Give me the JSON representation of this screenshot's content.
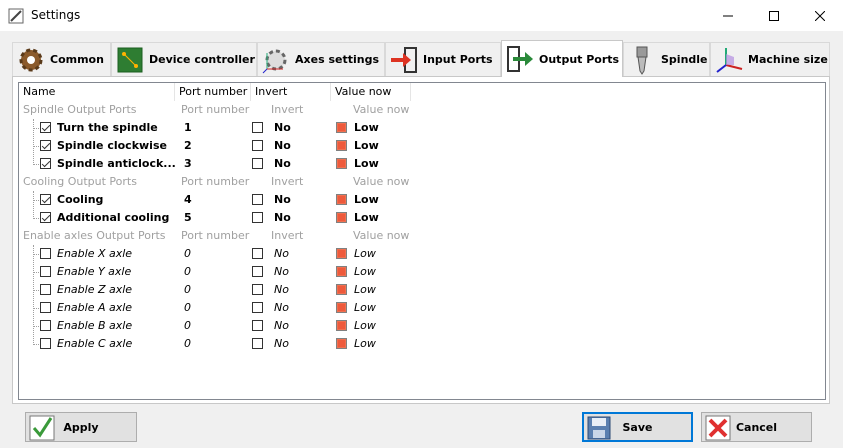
{
  "window": {
    "title": "Settings"
  },
  "tabs": [
    {
      "label": "Common",
      "icon": "gear-icon"
    },
    {
      "label": "Device controller",
      "icon": "circuit-board-icon"
    },
    {
      "label": "Axes settings",
      "icon": "axes-gear-icon"
    },
    {
      "label": "Input Ports",
      "icon": "input-arrow-icon"
    },
    {
      "label": "Output Ports",
      "icon": "output-arrow-icon",
      "active": true
    },
    {
      "label": "Spindle",
      "icon": "spindle-icon"
    },
    {
      "label": "Machine size",
      "icon": "machine-size-icon"
    }
  ],
  "table": {
    "headers": {
      "name": "Name",
      "port": "Port number",
      "invert": "Invert",
      "value": "Value now"
    },
    "groups": [
      {
        "name": "Spindle Output Ports",
        "port": "Port number",
        "invert": "Invert",
        "value": "Value now",
        "items": [
          {
            "name": "Turn the spindle",
            "checked": true,
            "port": "1",
            "invert": "No",
            "value": "Low"
          },
          {
            "name": "Spindle clockwise",
            "checked": true,
            "port": "2",
            "invert": "No",
            "value": "Low"
          },
          {
            "name": "Spindle anticlock...",
            "checked": true,
            "port": "3",
            "invert": "No",
            "value": "Low"
          }
        ]
      },
      {
        "name": "Cooling Output Ports",
        "port": "Port number",
        "invert": "Invert",
        "value": "Value now",
        "items": [
          {
            "name": "Cooling",
            "checked": true,
            "port": "4",
            "invert": "No",
            "value": "Low"
          },
          {
            "name": "Additional cooling",
            "checked": true,
            "port": "5",
            "invert": "No",
            "value": "Low"
          }
        ]
      },
      {
        "name": "Enable axles Output Ports",
        "port": "Port number",
        "invert": "Invert",
        "value": "Value now",
        "items": [
          {
            "name": "Enable X axle",
            "checked": false,
            "port": "0",
            "invert": "No",
            "value": "Low"
          },
          {
            "name": "Enable Y axle",
            "checked": false,
            "port": "0",
            "invert": "No",
            "value": "Low"
          },
          {
            "name": "Enable Z axle",
            "checked": false,
            "port": "0",
            "invert": "No",
            "value": "Low"
          },
          {
            "name": "Enable A axle",
            "checked": false,
            "port": "0",
            "invert": "No",
            "value": "Low"
          },
          {
            "name": "Enable B axle",
            "checked": false,
            "port": "0",
            "invert": "No",
            "value": "Low"
          },
          {
            "name": "Enable C axle",
            "checked": false,
            "port": "0",
            "invert": "No",
            "value": "Low"
          }
        ]
      }
    ]
  },
  "buttons": {
    "apply": "Apply",
    "save": "Save",
    "cancel": "Cancel"
  },
  "colors": {
    "led_low": "#ee5a3c",
    "accent": "#0078d7"
  }
}
